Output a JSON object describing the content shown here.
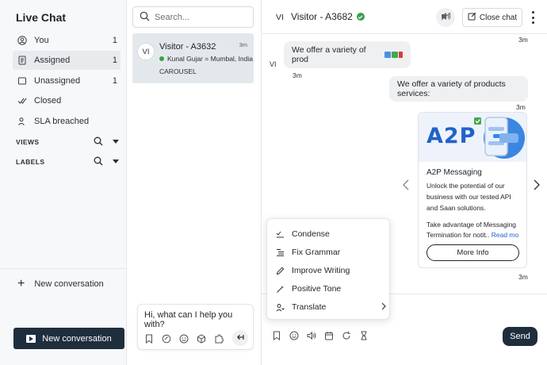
{
  "sidebar": {
    "title": "Live Chat",
    "items": [
      {
        "label": "You",
        "count": "1",
        "icon": "user-icon"
      },
      {
        "label": "Assigned",
        "count": "1",
        "icon": "document-icon"
      },
      {
        "label": "Unassigned",
        "count": "1",
        "icon": "inbox-icon"
      },
      {
        "label": "Closed",
        "count": "",
        "icon": "double-check-icon"
      },
      {
        "label": "SLA breached",
        "count": "",
        "icon": "person-alert-icon"
      }
    ],
    "sections": [
      {
        "label": "VIEWS"
      },
      {
        "label": "LABELS"
      }
    ],
    "new_conversation_link": "New conversation",
    "new_conversation_button": "New conversation"
  },
  "conversation_list": {
    "search_placeholder": "Search...",
    "conversations": [
      {
        "avatar_initials": "VI",
        "name": "Visitor - A3632",
        "time": "3m",
        "agent": "Kunal Gujar = Mumbal, India",
        "last_message": "CAROUSEL"
      }
    ],
    "reply_text": "Hi, what can I help you with?"
  },
  "chat": {
    "header": {
      "avatar_initials": "VI",
      "title": "Visitor - A3682",
      "close_label": "Close chat"
    },
    "messages": [
      {
        "time_above": "3m"
      },
      {
        "sender_initials": "VI",
        "text": "We offer a variety of prod",
        "time": "3m"
      },
      {
        "text": "We offer a variety of products services:",
        "time": "3m"
      }
    ],
    "card": {
      "image_text": "A2P",
      "title": "A2P Messaging",
      "description": "Unlock the potential of our business with our tested API and Saan solutions.",
      "description2": "Take advantage of Messaging Termination for notit..",
      "read_more": "Read mo",
      "button": "More Info",
      "time": "3m"
    },
    "ai_menu": [
      {
        "label": "Condense",
        "icon": "condense-icon"
      },
      {
        "label": "Fix Grammar",
        "icon": "list-icon"
      },
      {
        "label": "Improve Writing",
        "icon": "pencil-icon"
      },
      {
        "label": "Positive Tone",
        "icon": "wand-icon"
      },
      {
        "label": "Translate",
        "icon": "translate-icon"
      }
    ],
    "send_label": "Send"
  },
  "colors": {
    "primary_dark": "#1f2e3d",
    "active_bg": "#e3e8ec",
    "online_green": "#3aa14a",
    "link_blue": "#2163c9"
  }
}
